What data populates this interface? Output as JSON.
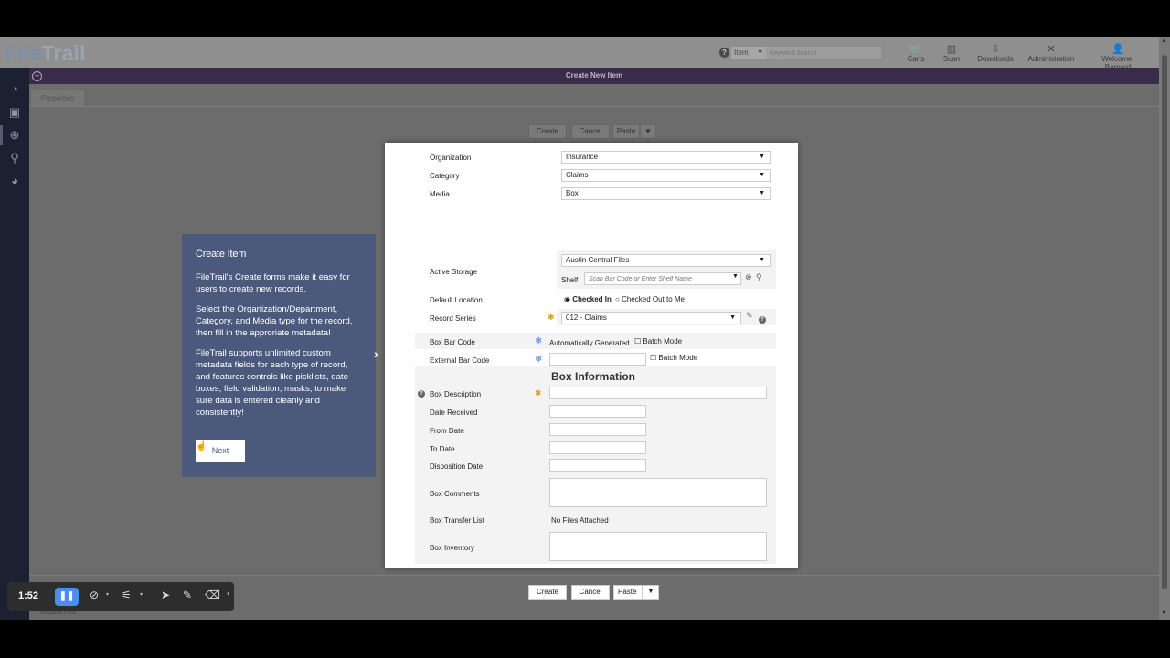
{
  "app": {
    "logo_file": "File",
    "logo_trail": "Trail"
  },
  "header": {
    "search_type": "Item",
    "search_placeholder": "Keyword Search",
    "nav": [
      {
        "label": "Carts",
        "icon": "cart-icon"
      },
      {
        "label": "Scan",
        "icon": "barcode-icon"
      },
      {
        "label": "Downloads",
        "icon": "download-icon"
      },
      {
        "label": "Administration",
        "icon": "tools-icon"
      },
      {
        "label": "Welcome, Bernard",
        "icon": "user-icon"
      }
    ]
  },
  "page": {
    "title": "Create New Item",
    "tab": "Properties",
    "required_note": "* Required Field"
  },
  "background_buttons": {
    "create": "Create",
    "cancel": "Cancel",
    "paste": "Paste"
  },
  "tour": {
    "title": "Create Item",
    "p1": "FileTrail's Create forms make it easy for users to create new records.",
    "p2": "Select the Organization/Department, Category, and Media type for the record, then fill in the approriate metadata!",
    "p3": "FileTrail supports unlimited custom metadata fields for each type of record, and features controls like picklists, date boxes, field validation, masks, to make sure data is entered cleanly and consistently!",
    "next": "Next"
  },
  "form": {
    "organization": {
      "label": "Organization",
      "value": "Insurance"
    },
    "category": {
      "label": "Category",
      "value": "Claims"
    },
    "media": {
      "label": "Media",
      "value": "Box"
    },
    "active_storage": {
      "label": "Active Storage",
      "value": "Austin Central Files",
      "shelf_label": "Shelf",
      "shelf_placeholder": "Scan Bar Code or Enter Shelf Name"
    },
    "default_location": {
      "label": "Default Location",
      "opt1": "Checked In",
      "opt2": "Checked Out to Me"
    },
    "record_series": {
      "label": "Record Series",
      "value": "012 - Claims"
    },
    "box_bar_code": {
      "label": "Box Bar Code",
      "auto": "Automatically Generated",
      "batch": "Batch Mode"
    },
    "external_bar_code": {
      "label": "External Bar Code",
      "batch": "Batch Mode"
    },
    "section": "Box Information",
    "box_description": "Box Description",
    "date_received": "Date Received",
    "from_date": "From Date",
    "to_date": "To Date",
    "disposition_date": "Disposition Date",
    "box_comments": "Box Comments",
    "box_transfer_list": {
      "label": "Box Transfer List",
      "value": "No Files Attached"
    },
    "box_inventory": "Box Inventory"
  },
  "modal_buttons": {
    "create": "Create",
    "cancel": "Cancel",
    "paste": "Paste"
  },
  "recorder": {
    "time": "1:52"
  }
}
